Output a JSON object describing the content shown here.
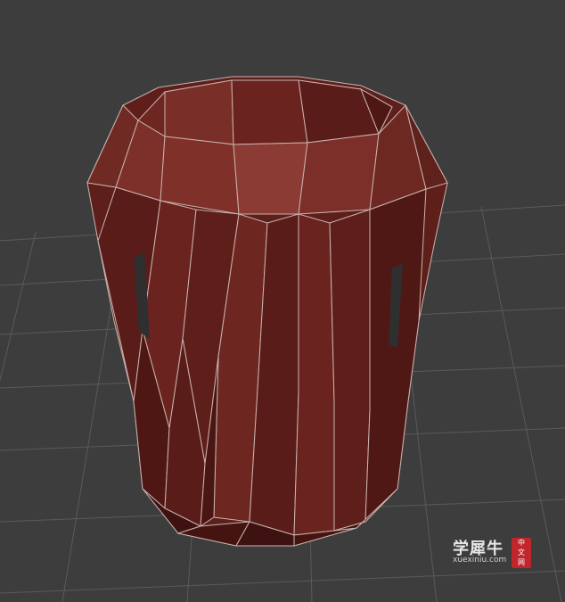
{
  "scene": {
    "background_color": "#3d3d3d",
    "grid_color": "#5a5a5a",
    "model_fill": "#6b2520",
    "model_fill_dark": "#3e1210",
    "model_fill_light": "#8a3a33",
    "wire_color": "#c9b3ae"
  },
  "watermark": {
    "main": "学犀牛",
    "url": "xuexiniu.com",
    "badge_chars": [
      "中",
      "文",
      "网"
    ]
  }
}
